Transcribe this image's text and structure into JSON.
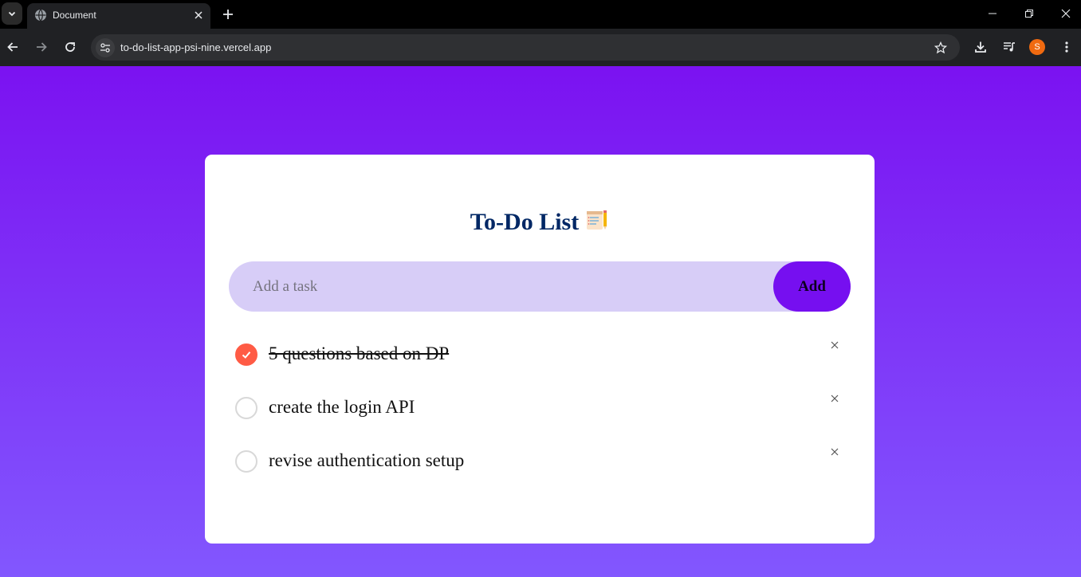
{
  "browser": {
    "tab_title": "Document",
    "url": "to-do-list-app-psi-nine.vercel.app",
    "profile_initial": "S"
  },
  "app": {
    "title": "To-Do List",
    "title_emoji": "📝",
    "input": {
      "placeholder": "Add a task",
      "value": ""
    },
    "add_label": "Add",
    "tasks": [
      {
        "text": "5 questions based on DP",
        "done": true
      },
      {
        "text": "create the login API",
        "done": false
      },
      {
        "text": "revise authentication setup",
        "done": false
      }
    ]
  },
  "colors": {
    "background_top": "#7b12f1",
    "background_bottom": "#8257fe",
    "title": "#002765",
    "input_bg": "#d7cdf7",
    "add_button": "#760ff0",
    "check_done": "#ff5b45"
  }
}
